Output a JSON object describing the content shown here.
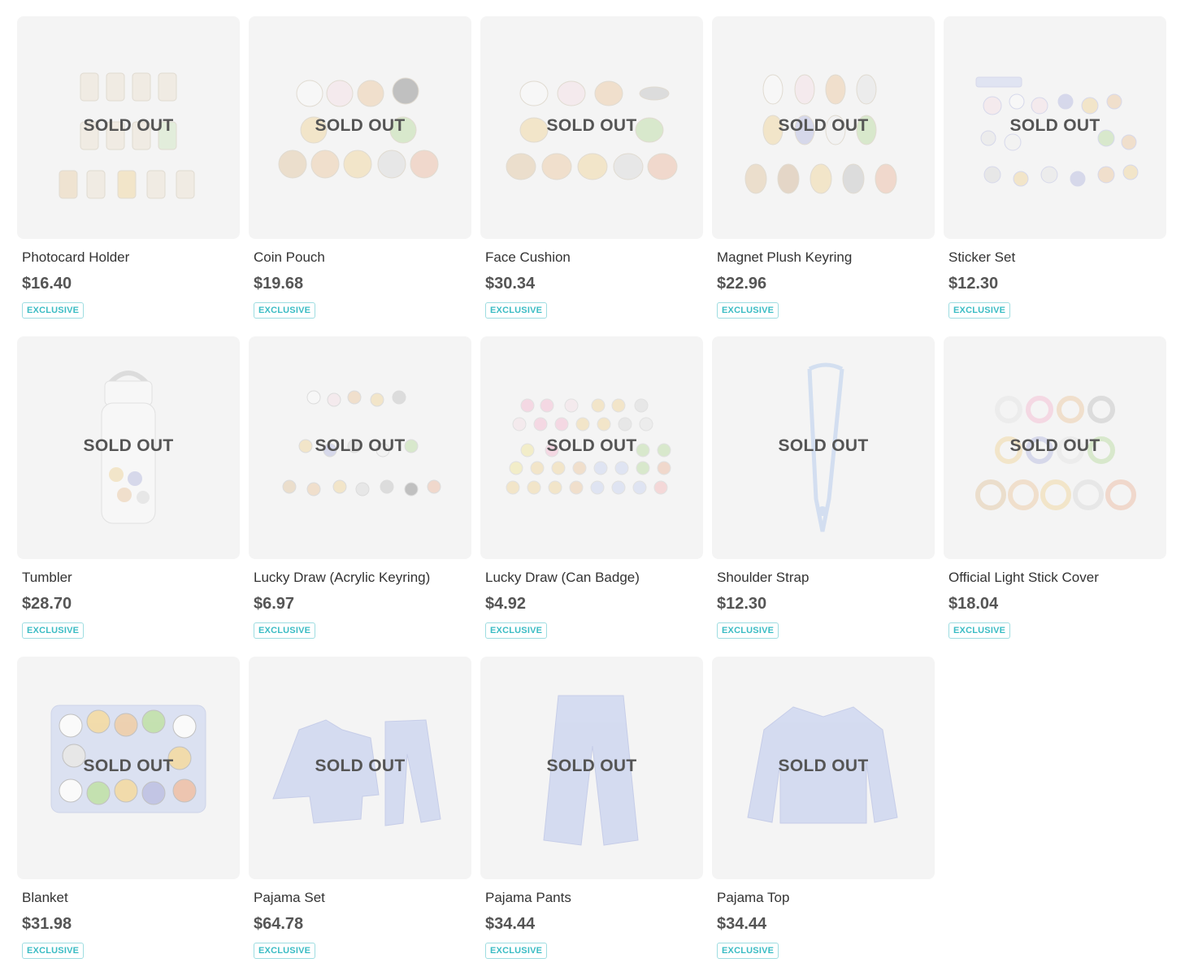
{
  "soldout_label": "SOLD OUT",
  "badge_label": "EXCLUSIVE",
  "colors": {
    "accent": "#3bbcc4",
    "thumb_bg": "#f4f4f4",
    "text": "#333333",
    "price": "#555555"
  },
  "products": [
    {
      "name": "Photocard Holder",
      "price": "$16.40",
      "icon": "photocard-holder-icon"
    },
    {
      "name": "Coin Pouch",
      "price": "$19.68",
      "icon": "coin-pouch-icon"
    },
    {
      "name": "Face Cushion",
      "price": "$30.34",
      "icon": "face-cushion-icon"
    },
    {
      "name": "Magnet Plush Keyring",
      "price": "$22.96",
      "icon": "plush-keyring-icon"
    },
    {
      "name": "Sticker Set",
      "price": "$12.30",
      "icon": "sticker-set-icon"
    },
    {
      "name": "Tumbler",
      "price": "$28.70",
      "icon": "tumbler-icon"
    },
    {
      "name": "Lucky Draw (Acrylic Keyring)",
      "price": "$6.97",
      "icon": "acrylic-keyring-icon"
    },
    {
      "name": "Lucky Draw (Can Badge)",
      "price": "$4.92",
      "icon": "can-badge-icon"
    },
    {
      "name": "Shoulder Strap",
      "price": "$12.30",
      "icon": "shoulder-strap-icon"
    },
    {
      "name": "Official Light Stick Cover",
      "price": "$18.04",
      "icon": "light-stick-cover-icon"
    },
    {
      "name": "Blanket",
      "price": "$31.98",
      "icon": "blanket-icon"
    },
    {
      "name": "Pajama Set",
      "price": "$64.78",
      "icon": "pajama-set-icon"
    },
    {
      "name": "Pajama Pants",
      "price": "$34.44",
      "icon": "pajama-pants-icon"
    },
    {
      "name": "Pajama Top",
      "price": "$34.44",
      "icon": "pajama-top-icon"
    }
  ]
}
